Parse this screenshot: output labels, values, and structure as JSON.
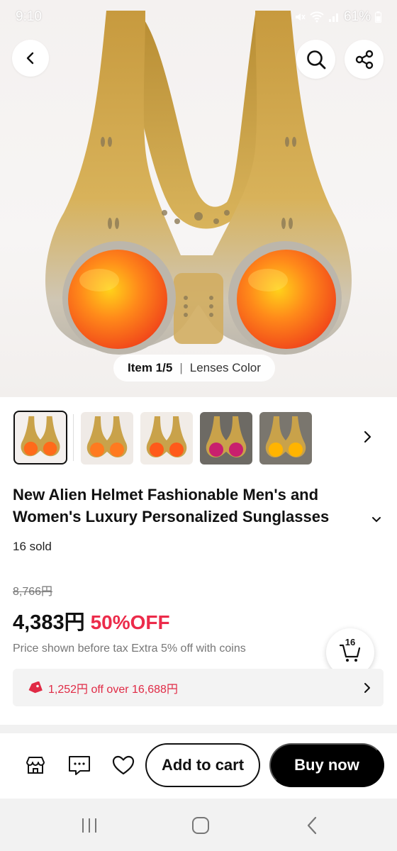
{
  "status_bar": {
    "time": "9:10",
    "battery": "61%"
  },
  "hero": {
    "item_label": "Item 1/5",
    "separator": "|",
    "variant_label": "Lenses Color"
  },
  "thumbnails": {
    "lens_colors": [
      "#ff6a1a",
      "#ff7a20",
      "#ff5a1a",
      "#c8206e",
      "#ffb400"
    ],
    "active_index": 0
  },
  "product": {
    "title": "New Alien Helmet Fashionable Men's and Women's Luxury Personalized Sunglasses Driving",
    "sold": "16 sold",
    "original_price": "8,766円",
    "price": "4,383円",
    "discount": "50%OFF",
    "tax_note": "Price shown before tax Extra 5% off with coins"
  },
  "cart": {
    "count": "16"
  },
  "coupon": {
    "text": "1,252円 off over 16,688円"
  },
  "actions": {
    "add_to_cart": "Add to cart",
    "buy_now": "Buy now"
  },
  "colors": {
    "accent_red": "#ec2b4a",
    "gold": "#c9a24a",
    "lens_orange": "#ff6a1a"
  }
}
